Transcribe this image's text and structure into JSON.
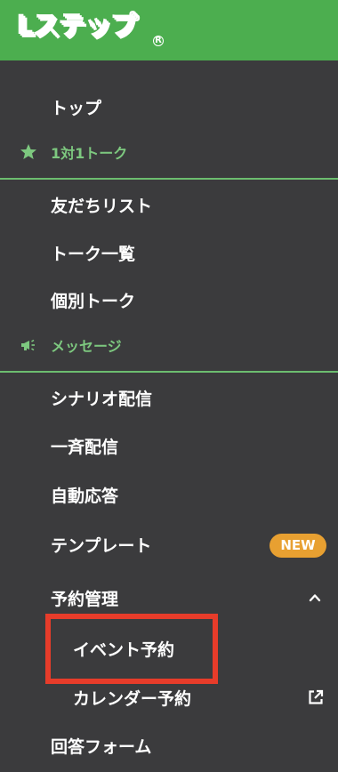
{
  "brand": {
    "logo_text": "Lステップ",
    "registered_mark": "R"
  },
  "menu": {
    "top": "トップ",
    "section_chat": "1対1トーク",
    "friends_list": "友だちリスト",
    "talk_list": "トーク一覧",
    "individual_talk": "個別トーク",
    "section_message": "メッセージ",
    "scenario": "シナリオ配信",
    "broadcast": "一斉配信",
    "auto_reply": "自動応答",
    "template": "テンプレート",
    "template_badge": "NEW",
    "reservation": "予約管理",
    "event_reservation": "イベント予約",
    "calendar_reservation": "カレンダー予約",
    "answer_form": "回答フォーム"
  },
  "colors": {
    "sidebar_bg": "#3b3b3d",
    "header_bg": "#4cae4f",
    "section_text": "#7dc87f",
    "badge_bg": "#e8a031",
    "highlight_border": "#e73c2a"
  }
}
